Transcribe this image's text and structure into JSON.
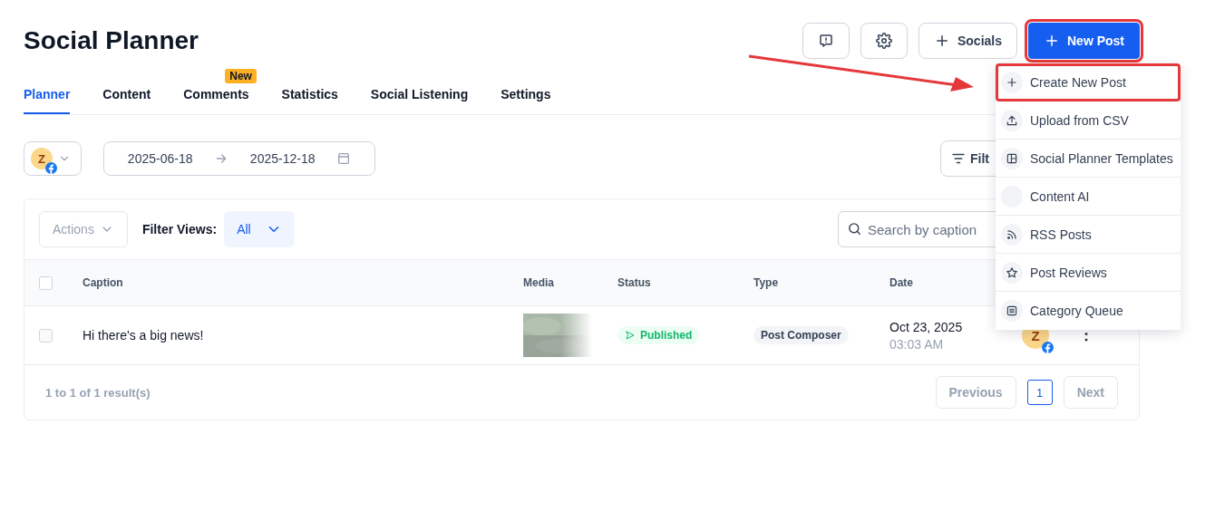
{
  "page": {
    "title": "Social Planner"
  },
  "header_buttons": {
    "socials": {
      "label": "Socials"
    },
    "new_post": {
      "label": "New Post",
      "highlighted": true
    }
  },
  "tabs": [
    {
      "label": "Planner",
      "selected": true
    },
    {
      "label": "Content",
      "selected": false
    },
    {
      "label": "Comments",
      "selected": false,
      "badge": "New"
    },
    {
      "label": "Statistics",
      "selected": false
    },
    {
      "label": "Social Listening",
      "selected": false
    },
    {
      "label": "Settings",
      "selected": false
    }
  ],
  "filters": {
    "account_avatar": "Z",
    "date_from": "2025-06-18",
    "date_to": "2025-12-18",
    "filter_button": "Filt"
  },
  "toolbar": {
    "actions": "Actions",
    "filter_views_label": "Filter Views:",
    "filter_view_value": "All",
    "search_placeholder": "Search by caption"
  },
  "table": {
    "all_selected": false,
    "columns": [
      "Caption",
      "Media",
      "Status",
      "Type",
      "Date"
    ],
    "rows": [
      {
        "selected": false,
        "caption": "Hi there's a big news!",
        "status": "Published",
        "type": "Post Composer",
        "date": "Oct 23, 2025",
        "time": "03:03 AM",
        "account_avatar": "Z"
      }
    ]
  },
  "pagination": {
    "summary": "1 to 1 of 1 result(s)",
    "previous": "Previous",
    "pages": [
      {
        "label": "1",
        "selected": true
      }
    ],
    "next": "Next"
  },
  "new_post_menu": [
    {
      "label": "Create New Post",
      "highlighted": true
    },
    {
      "label": "Upload from CSV",
      "highlighted": false
    },
    {
      "label": "Social Planner Templates",
      "highlighted": false
    },
    {
      "label": "Content AI",
      "highlighted": false
    },
    {
      "label": "RSS Posts",
      "highlighted": false
    },
    {
      "label": "Post Reviews",
      "highlighted": false
    },
    {
      "label": "Category Queue",
      "highlighted": false
    }
  ]
}
